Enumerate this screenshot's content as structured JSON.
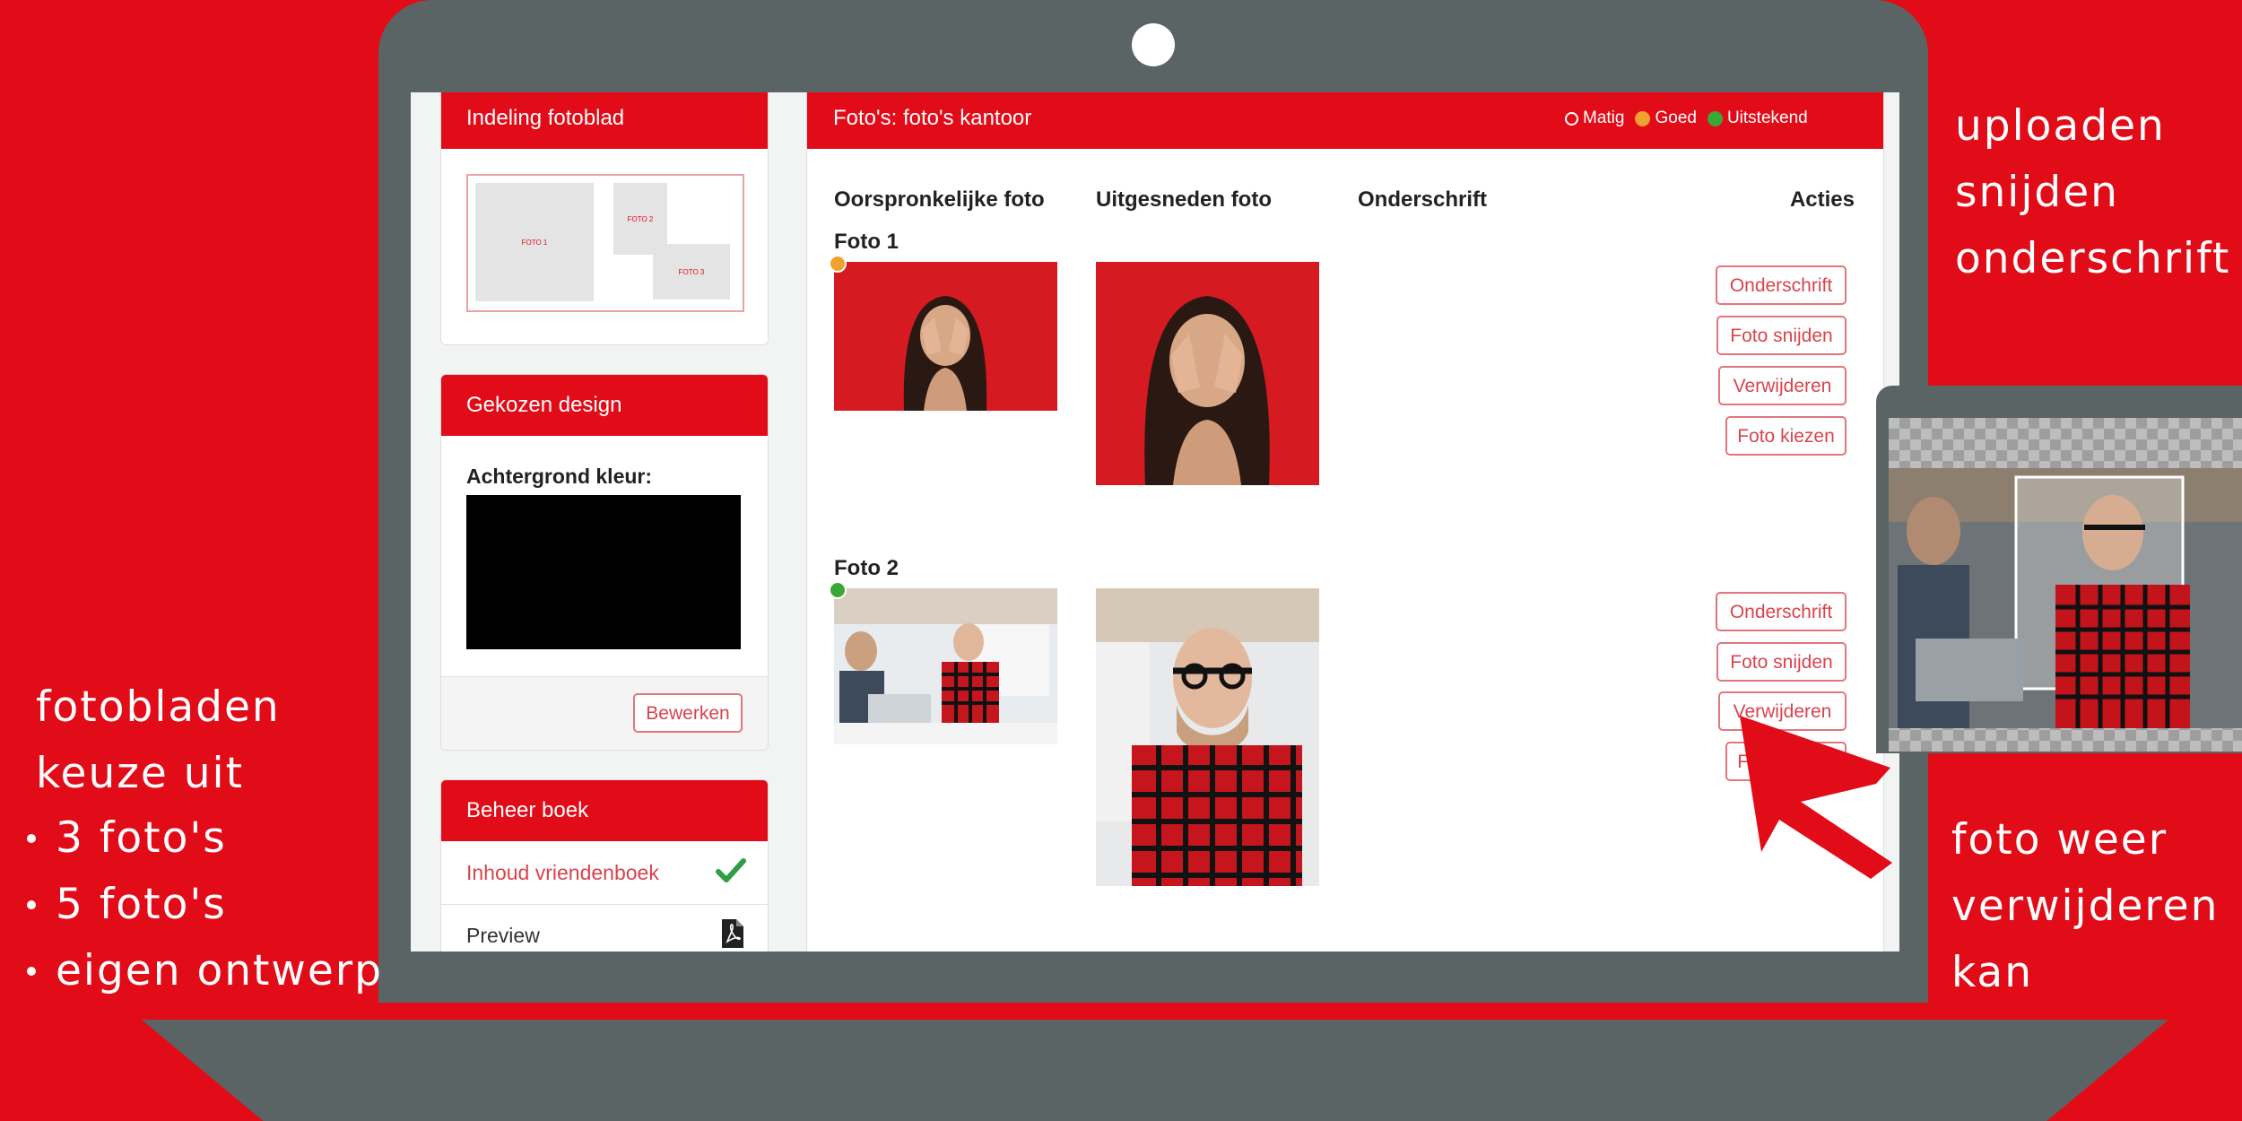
{
  "laptop": {
    "body_color": "#5b6464",
    "background_color": "#e20b18"
  },
  "sidebar": {
    "layout_panel": {
      "title": "Indeling fotoblad",
      "slots": [
        "FOTO 1",
        "FOTO 2",
        "FOTO 3"
      ]
    },
    "design_panel": {
      "title": "Gekozen design",
      "bg_label": "Achtergrond kleur:",
      "bg_color": "#000000",
      "edit_label": "Bewerken"
    },
    "manage_panel": {
      "title": "Beheer boek",
      "items": [
        {
          "label": "Inhoud vriendenboek",
          "icon": "checkmark-icon"
        },
        {
          "label": "Preview",
          "icon": "pdf-icon"
        }
      ]
    }
  },
  "main": {
    "title": "Foto's: foto's kantoor",
    "legend": [
      {
        "label": "Matig",
        "color": "#ffffff"
      },
      {
        "label": "Goed",
        "color": "#f0a22e"
      },
      {
        "label": "Uitstekend",
        "color": "#3aa835"
      }
    ],
    "columns": [
      "Oorspronkelijke foto",
      "Uitgesneden foto",
      "Onderschrift",
      "Acties"
    ],
    "photos": [
      {
        "label": "Foto 1",
        "quality_color": "#f0a22e"
      },
      {
        "label": "Foto 2",
        "quality_color": "#3aa835"
      }
    ],
    "actions": [
      "Onderschrift",
      "Foto snijden",
      "Verwijderen",
      "Foto kiezen"
    ]
  },
  "annotations": {
    "top_right": [
      "uploaden",
      "snijden",
      "onderschrift"
    ],
    "left_heading": [
      "fotobladen",
      "keuze uit"
    ],
    "left_bullets": [
      "3 foto's",
      "5 foto's",
      "eigen ontwerp"
    ],
    "bottom_right": [
      "foto weer",
      "verwijderen",
      "kan"
    ]
  }
}
